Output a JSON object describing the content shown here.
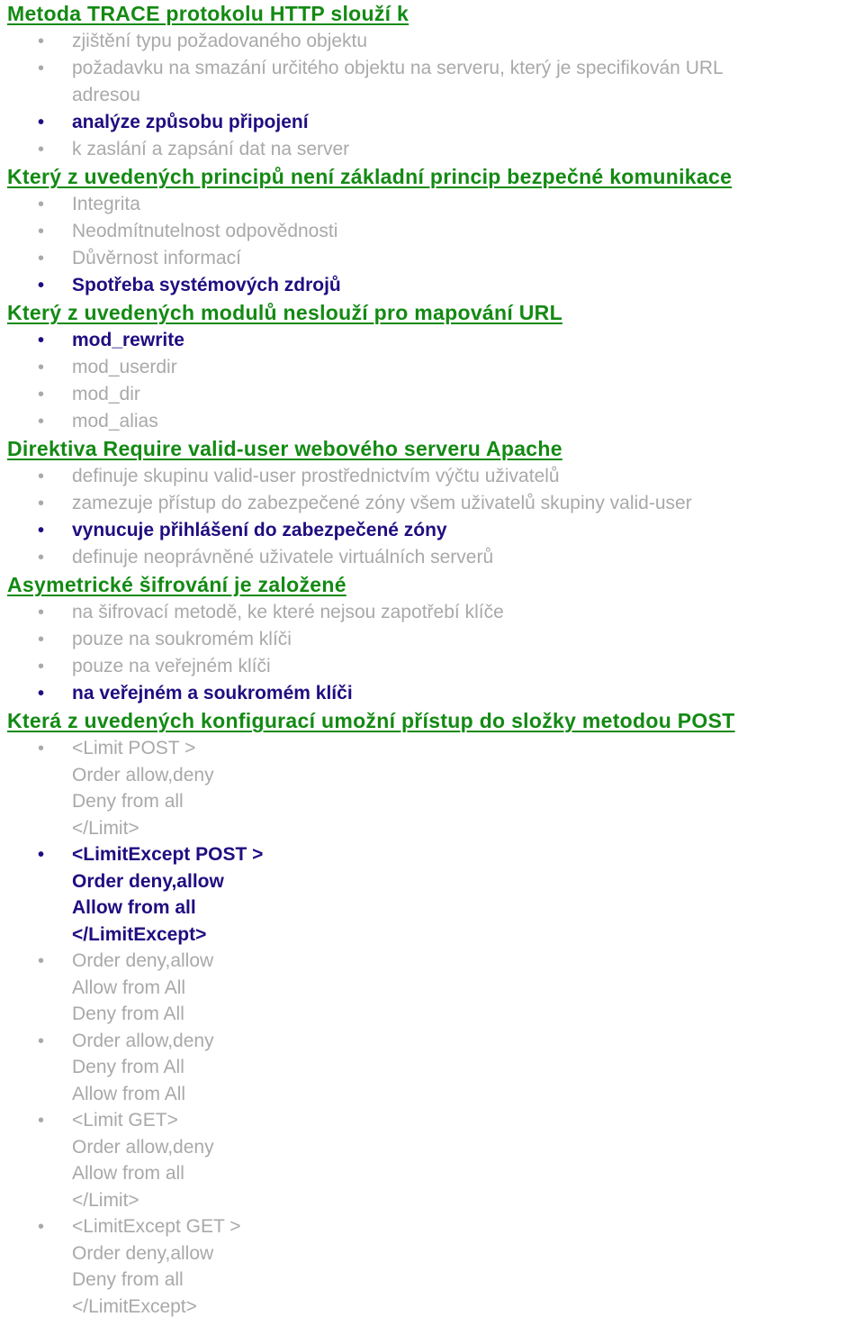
{
  "colors": {
    "heading": "#138a13",
    "correct": "#1f0d80",
    "wrong": "#a9a9a9"
  },
  "questions": [
    {
      "title": "Metoda TRACE protokolu HTTP slouží k ",
      "answers": [
        {
          "correct": false,
          "lines": [
            "zjištění typu požadovaného objektu"
          ]
        },
        {
          "correct": false,
          "lines": [
            "požadavku na smazání určitého objektu na serveru, který je specifikován URL",
            "adresou"
          ]
        },
        {
          "correct": true,
          "lines": [
            "analýze způsobu připojení"
          ]
        },
        {
          "correct": false,
          "lines": [
            "k zaslání a zapsání dat na server"
          ]
        }
      ]
    },
    {
      "title": "Který z uvedených principů není základní princip bezpečné komunikace",
      "answers": [
        {
          "correct": false,
          "lines": [
            "Integrita"
          ]
        },
        {
          "correct": false,
          "lines": [
            "Neodmítnutelnost odpovědnosti"
          ]
        },
        {
          "correct": false,
          "lines": [
            "Důvěrnost informací"
          ]
        },
        {
          "correct": true,
          "lines": [
            "Spotřeba systémových zdrojů"
          ]
        }
      ]
    },
    {
      "title": "Který z uvedených modulů neslouží pro mapování URL",
      "answers": [
        {
          "correct": true,
          "lines": [
            "mod_rewrite"
          ]
        },
        {
          "correct": false,
          "lines": [
            "mod_userdir"
          ]
        },
        {
          "correct": false,
          "lines": [
            "mod_dir"
          ]
        },
        {
          "correct": false,
          "lines": [
            "mod_alias"
          ]
        }
      ]
    },
    {
      "title": "Direktiva Require valid-user webového serveru Apache",
      "answers": [
        {
          "correct": false,
          "lines": [
            "definuje skupinu valid-user prostřednictvím výčtu uživatelů"
          ]
        },
        {
          "correct": false,
          "lines": [
            "zamezuje přístup do zabezpečené zóny všem uživatelů skupiny valid-user"
          ]
        },
        {
          "correct": true,
          "lines": [
            "vynucuje přihlášení do zabezpečené zóny"
          ]
        },
        {
          "correct": false,
          "lines": [
            "definuje neoprávněné uživatele virtuálních serverů"
          ]
        }
      ]
    },
    {
      "title": "Asymetrické šifrování je založené",
      "answers": [
        {
          "correct": false,
          "lines": [
            "na šifrovací metodě, ke které nejsou zapotřebí klíče"
          ]
        },
        {
          "correct": false,
          "lines": [
            "pouze na soukromém klíči"
          ]
        },
        {
          "correct": false,
          "lines": [
            "pouze na veřejném klíči"
          ]
        },
        {
          "correct": true,
          "lines": [
            "na veřejném a soukromém klíči"
          ]
        }
      ]
    },
    {
      "title": "Která z uvedených konfigurací umožní přístup do složky metodou POST",
      "answers": [
        {
          "correct": false,
          "lines": [
            "<Limit POST >",
            "Order allow,deny",
            "Deny from all",
            "</Limit>"
          ]
        },
        {
          "correct": true,
          "lines": [
            "<LimitExcept POST >",
            "Order deny,allow",
            "Allow from all",
            "</LimitExcept>"
          ]
        },
        {
          "correct": false,
          "lines": [
            "Order deny,allow",
            "Allow from All",
            "Deny from All"
          ]
        },
        {
          "correct": false,
          "lines": [
            "Order allow,deny",
            "Deny from All",
            "Allow from All"
          ]
        },
        {
          "correct": false,
          "lines": [
            "<Limit GET>",
            "Order allow,deny",
            "Allow from all",
            "</Limit>"
          ]
        },
        {
          "correct": false,
          "lines": [
            "<LimitExcept GET >",
            "Order deny,allow",
            "Deny from all",
            "</LimitExcept>"
          ]
        }
      ]
    }
  ],
  "bullet_glyph": "•"
}
